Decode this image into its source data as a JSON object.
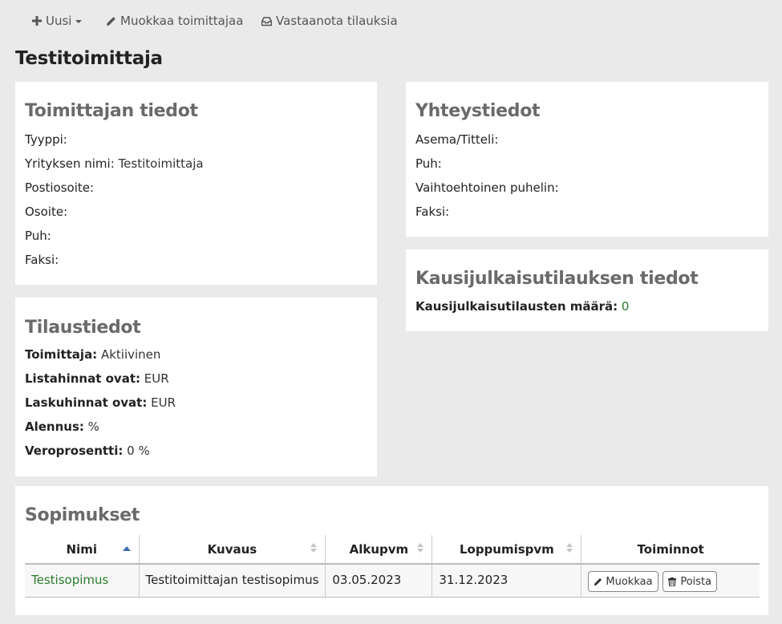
{
  "toolbar": {
    "new_label": "Uusi",
    "edit_vendor_label": "Muokkaa toimittajaa",
    "receive_orders_label": "Vastaanota tilauksia"
  },
  "page_title": "Testitoimittaja",
  "vendor_info": {
    "heading": "Toimittajan tiedot",
    "type_label": "Tyyppi:",
    "type_value": "",
    "company_label": "Yrityksen nimi:",
    "company_value": "Testitoimittaja",
    "postal_label": "Postiosoite:",
    "postal_value": "",
    "address_label": "Osoite:",
    "address_value": "",
    "phone_label": "Puh:",
    "phone_value": "",
    "fax_label": "Faksi:",
    "fax_value": ""
  },
  "contact_info": {
    "heading": "Yhteystiedot",
    "position_label": "Asema/Titteli:",
    "phone_label": "Puh:",
    "alt_phone_label": "Vaihtoehtoinen puhelin:",
    "fax_label": "Faksi:"
  },
  "serials": {
    "heading": "Kausijulkaisutilauksen tiedot",
    "count_label": "Kausijulkaisutilausten määrä:",
    "count_value": "0"
  },
  "ordering": {
    "heading": "Tilaustiedot",
    "vendor_label": "Toimittaja:",
    "vendor_value": "Aktiivinen",
    "list_prices_label": "Listahinnat ovat:",
    "list_prices_value": "EUR",
    "invoice_prices_label": "Laskuhinnat ovat:",
    "invoice_prices_value": "EUR",
    "discount_label": "Alennus:",
    "discount_value": "%",
    "tax_label": "Veroprosentti:",
    "tax_value": "0 %"
  },
  "contracts": {
    "heading": "Sopimukset",
    "columns": [
      "Nimi",
      "Kuvaus",
      "Alkupvm",
      "Loppumispvm",
      "Toiminnot"
    ],
    "rows": [
      {
        "name": "Testisopimus",
        "description": "Testitoimittajan testisopimus",
        "start": "03.05.2023",
        "end": "31.12.2023",
        "edit_label": "Muokkaa",
        "delete_label": "Poista"
      }
    ]
  },
  "colors": {
    "link_green": "#2a7a2a",
    "heading_grey": "#6a6a6a",
    "background": "#eaeaea",
    "sort_active": "#3a6fb0"
  }
}
